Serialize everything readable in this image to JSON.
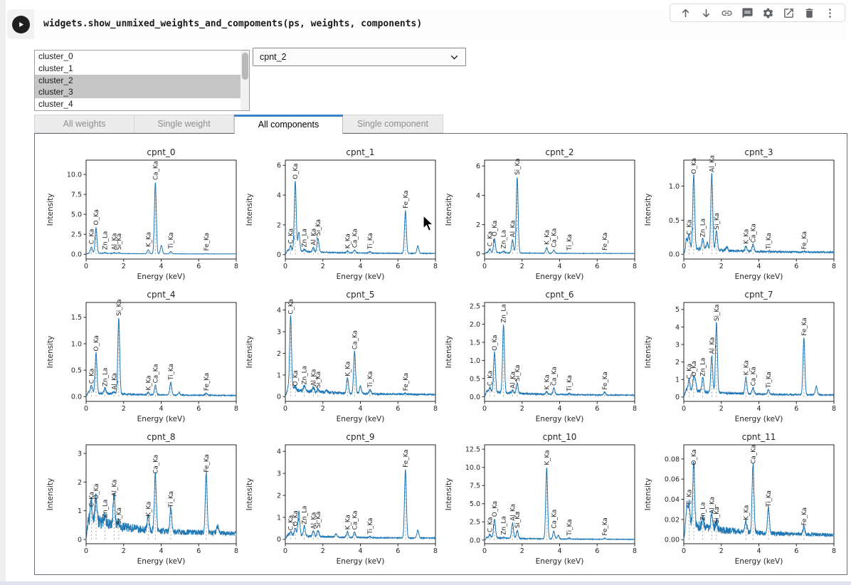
{
  "cell": {
    "code": "widgets.show_unmixed_weights_and_compoments(ps, weights, components)",
    "play_label": "run-cell"
  },
  "toolbar": {
    "icons": [
      {
        "name": "move-cell-up-icon"
      },
      {
        "name": "move-cell-down-icon"
      },
      {
        "name": "copy-link-icon"
      },
      {
        "name": "comment-icon"
      },
      {
        "name": "settings-icon"
      },
      {
        "name": "open-in-new-icon"
      },
      {
        "name": "delete-cell-icon"
      },
      {
        "name": "more-options-icon"
      }
    ]
  },
  "cluster_list": {
    "items": [
      {
        "label": "cluster_0",
        "selected": false
      },
      {
        "label": "cluster_1",
        "selected": false
      },
      {
        "label": "cluster_2",
        "selected": true
      },
      {
        "label": "cluster_3",
        "selected": true
      },
      {
        "label": "cluster_4",
        "selected": false
      }
    ]
  },
  "component_dropdown": {
    "value": "cpnt_2"
  },
  "tabs": [
    {
      "label": "All weights",
      "active": false,
      "width": 141
    },
    {
      "label": "Single weight",
      "active": false,
      "width": 140
    },
    {
      "label": "All components",
      "active": true,
      "width": 153
    },
    {
      "label": "Single component",
      "active": false,
      "width": 141
    }
  ],
  "colors": {
    "line": "#1f77b4",
    "tab_accent": "#3c82c4",
    "axis_text": "#262626",
    "icon_gray": "#5f6368",
    "peak_guide": "#a8a8a8"
  },
  "chart_data": [
    {
      "type": "line",
      "title": "cpnt_0",
      "xlabel": "Energy (keV)",
      "ylabel": "Intensity",
      "xlim": [
        0,
        8
      ],
      "xticks": [
        0,
        2,
        4,
        6,
        8
      ],
      "ylim": [
        -0.6,
        11.8
      ],
      "ytick_vals": [
        0,
        2.5,
        5,
        7.5,
        10
      ],
      "yticks": [
        "0.0",
        "2.5",
        "5.0",
        "7.5",
        "10.0"
      ],
      "peaks": [
        {
          "label": "C_Ka",
          "x": 0.28,
          "h": 0.8
        },
        {
          "label": "O_Ka",
          "x": 0.53,
          "h": 3.2
        },
        {
          "label": "Zn_La",
          "x": 1.01,
          "h": 0.12
        },
        {
          "label": "Al_Ka",
          "x": 1.49,
          "h": 0.1
        },
        {
          "label": "Si_Ka",
          "x": 1.74,
          "h": 0.12
        },
        {
          "label": "K_Ka",
          "x": 3.31,
          "h": 0.5
        },
        {
          "label": "Ca_Ka",
          "x": 3.69,
          "h": 8.9
        },
        {
          "label": "Ti_Ka",
          "x": 4.51,
          "h": 0.3
        },
        {
          "label": "Fe_Ka",
          "x": 6.4,
          "h": 0.05
        }
      ],
      "extra_peaks": [
        {
          "x": 4.01,
          "h": 1.05
        }
      ],
      "baseline": 0.08,
      "noise": 0.06,
      "seed": 1
    },
    {
      "type": "line",
      "title": "cpnt_1",
      "xlabel": "Energy (keV)",
      "ylabel": "Intensity",
      "xlim": [
        0,
        8
      ],
      "xticks": [
        0,
        2,
        4,
        6,
        8
      ],
      "ylim": [
        -0.3,
        6.35
      ],
      "ytick_vals": [
        0,
        2,
        4,
        6
      ],
      "yticks": [
        "0",
        "2",
        "4",
        "6"
      ],
      "peaks": [
        {
          "label": "C_Ka",
          "x": 0.28,
          "h": 0.35
        },
        {
          "label": "O_Ka",
          "x": 0.53,
          "h": 4.7
        },
        {
          "label": "Zn_La",
          "x": 1.01,
          "h": 0.15
        },
        {
          "label": "Al_Ka",
          "x": 1.49,
          "h": 0.3
        },
        {
          "label": "Si_Ka",
          "x": 1.74,
          "h": 0.95
        },
        {
          "label": "K_Ka",
          "x": 3.31,
          "h": 0.12
        },
        {
          "label": "Ca_Ka",
          "x": 3.69,
          "h": 0.18
        },
        {
          "label": "Ti_Ka",
          "x": 4.51,
          "h": 0.1
        },
        {
          "label": "Fe_Ka",
          "x": 6.4,
          "h": 2.85
        }
      ],
      "extra_peaks": [
        {
          "x": 0.72,
          "h": 1.3
        },
        {
          "x": 7.06,
          "h": 0.5
        }
      ],
      "baseline": 0.15,
      "noise": 0.1,
      "seed": 2
    },
    {
      "type": "line",
      "title": "cpnt_2",
      "xlabel": "Energy (keV)",
      "ylabel": "Intensity",
      "xlim": [
        0,
        8
      ],
      "xticks": [
        0,
        2,
        4,
        6,
        8
      ],
      "ylim": [
        -0.35,
        6.4
      ],
      "ytick_vals": [
        0,
        2,
        4,
        6
      ],
      "yticks": [
        "0",
        "2",
        "4",
        "6"
      ],
      "peaks": [
        {
          "label": "C_Ka",
          "x": 0.28,
          "h": 0.25
        },
        {
          "label": "O_Ka",
          "x": 0.53,
          "h": 0.95
        },
        {
          "label": "Zn_La",
          "x": 1.01,
          "h": 0.12
        },
        {
          "label": "Al_Ka",
          "x": 1.49,
          "h": 0.9
        },
        {
          "label": "Si_Ka",
          "x": 1.74,
          "h": 5.15
        },
        {
          "label": "K_Ka",
          "x": 3.31,
          "h": 0.4
        },
        {
          "label": "Ca_Ka",
          "x": 3.69,
          "h": 0.22
        },
        {
          "label": "Ti_Ka",
          "x": 4.51,
          "h": 0.02
        },
        {
          "label": "Fe_Ka",
          "x": 6.4,
          "h": 0.02
        }
      ],
      "extra_peaks": [],
      "baseline": 0.05,
      "noise": 0.05,
      "seed": 3
    },
    {
      "type": "line",
      "title": "cpnt_3",
      "xlabel": "Energy (keV)",
      "ylabel": "Intensity",
      "xlim": [
        0,
        8
      ],
      "xticks": [
        0,
        2,
        4,
        6,
        8
      ],
      "ylim": [
        -0.07,
        1.38
      ],
      "ytick_vals": [
        0,
        0.5,
        1
      ],
      "yticks": [
        "0.0",
        "0.5",
        "1.0"
      ],
      "peaks": [
        {
          "label": "C_Ka",
          "x": 0.28,
          "h": 0.18
        },
        {
          "label": "O_Ka",
          "x": 0.53,
          "h": 1.08
        },
        {
          "label": "Zn_La",
          "x": 1.01,
          "h": 0.16
        },
        {
          "label": "Al_Ka",
          "x": 1.49,
          "h": 1.12
        },
        {
          "label": "Si_Ka",
          "x": 1.74,
          "h": 0.28
        },
        {
          "label": "K_Ka",
          "x": 3.31,
          "h": 0.08
        },
        {
          "label": "Ca_Ka",
          "x": 3.69,
          "h": 0.1
        },
        {
          "label": "Ti_Ka",
          "x": 4.51,
          "h": 0.01
        },
        {
          "label": "Fe_Ka",
          "x": 6.4,
          "h": 0.01
        }
      ],
      "extra_peaks": [
        {
          "x": 0.15,
          "h": 0.12
        },
        {
          "x": 1.25,
          "h": 0.1
        },
        {
          "x": 2.3,
          "h": 0.05
        }
      ],
      "baseline": 0.05,
      "noise": 0.05,
      "seed": 4
    },
    {
      "type": "line",
      "title": "cpnt_4",
      "xlabel": "Energy (keV)",
      "ylabel": "Intensity",
      "xlim": [
        0,
        8
      ],
      "xticks": [
        0,
        2,
        4,
        6,
        8
      ],
      "ylim": [
        -0.09,
        1.78
      ],
      "ytick_vals": [
        0,
        0.5,
        1,
        1.5
      ],
      "yticks": [
        "0.0",
        "0.5",
        "1.0",
        "1.5"
      ],
      "peaks": [
        {
          "label": "C_Ka",
          "x": 0.28,
          "h": 0.14
        },
        {
          "label": "O_Ka",
          "x": 0.53,
          "h": 0.76
        },
        {
          "label": "Zn_La",
          "x": 1.01,
          "h": 0.1
        },
        {
          "label": "Al_Ka",
          "x": 1.49,
          "h": 0.04
        },
        {
          "label": "Si_Ka",
          "x": 1.74,
          "h": 1.44
        },
        {
          "label": "K_Ka",
          "x": 3.31,
          "h": 0.04
        },
        {
          "label": "Ca_Ka",
          "x": 3.69,
          "h": 0.18
        },
        {
          "label": "Ti_Ka",
          "x": 4.51,
          "h": 0.24
        },
        {
          "label": "Fe_Ka",
          "x": 6.4,
          "h": 0.04
        }
      ],
      "extra_peaks": [
        {
          "x": 4.95,
          "h": 0.05
        }
      ],
      "baseline": 0.04,
      "noise": 0.04,
      "seed": 5
    },
    {
      "type": "line",
      "title": "cpnt_5",
      "xlabel": "Energy (keV)",
      "ylabel": "Intensity",
      "xlim": [
        0,
        8
      ],
      "xticks": [
        0,
        2,
        4,
        6,
        8
      ],
      "ylim": [
        -0.22,
        4.35
      ],
      "ytick_vals": [
        0,
        1,
        2,
        3,
        4
      ],
      "yticks": [
        "0",
        "1",
        "2",
        "3",
        "4"
      ],
      "peaks": [
        {
          "label": "C_Ka",
          "x": 0.28,
          "h": 3.45
        },
        {
          "label": "O_Ka",
          "x": 0.53,
          "h": 0.15
        },
        {
          "label": "Zn_La",
          "x": 1.01,
          "h": 0.25
        },
        {
          "label": "Al_Ka",
          "x": 1.49,
          "h": 0.2
        },
        {
          "label": "Si_Ka",
          "x": 1.74,
          "h": 0.12
        },
        {
          "label": "K_Ka",
          "x": 3.31,
          "h": 0.7
        },
        {
          "label": "Ca_Ka",
          "x": 3.69,
          "h": 1.95
        },
        {
          "label": "Ti_Ka",
          "x": 4.51,
          "h": 0.2
        },
        {
          "label": "Fe_Ka",
          "x": 6.4,
          "h": 0.06
        }
      ],
      "extra_peaks": [
        {
          "x": 4.0,
          "h": 0.35
        },
        {
          "x": 2.2,
          "h": 0.1
        }
      ],
      "baseline": 0.18,
      "noise": 0.16,
      "seed": 6
    },
    {
      "type": "line",
      "title": "cpnt_6",
      "xlabel": "Energy (keV)",
      "ylabel": "Intensity",
      "xlim": [
        0,
        8
      ],
      "xticks": [
        0,
        2,
        4,
        6,
        8
      ],
      "ylim": [
        -0.13,
        2.6
      ],
      "ytick_vals": [
        0,
        0.5,
        1,
        1.5,
        2,
        2.5
      ],
      "yticks": [
        "0.0",
        "0.5",
        "1.0",
        "1.5",
        "2.0",
        "2.5"
      ],
      "peaks": [
        {
          "label": "C_Ka",
          "x": 0.28,
          "h": 0.12
        },
        {
          "label": "O_Ka",
          "x": 0.53,
          "h": 1.1
        },
        {
          "label": "Zn_La",
          "x": 1.01,
          "h": 1.88
        },
        {
          "label": "Al_Ka",
          "x": 1.49,
          "h": 0.08
        },
        {
          "label": "Si_Ka",
          "x": 1.74,
          "h": 0.28
        },
        {
          "label": "K_Ka",
          "x": 3.31,
          "h": 0.07
        },
        {
          "label": "Ca_Ka",
          "x": 3.69,
          "h": 0.18
        },
        {
          "label": "Ti_Ka",
          "x": 4.51,
          "h": 0.03
        },
        {
          "label": "Fe_Ka",
          "x": 6.4,
          "h": 0.08
        }
      ],
      "extra_peaks": [],
      "baseline": 0.08,
      "noise": 0.06,
      "seed": 7
    },
    {
      "type": "line",
      "title": "cpnt_7",
      "xlabel": "Energy (keV)",
      "ylabel": "Intensity",
      "xlim": [
        0,
        8
      ],
      "xticks": [
        0,
        2,
        4,
        6,
        8
      ],
      "ylim": [
        -0.25,
        5.4
      ],
      "ytick_vals": [
        0,
        1,
        2,
        3,
        4,
        5
      ],
      "yticks": [
        "0",
        "1",
        "2",
        "3",
        "4",
        "5"
      ],
      "peaks": [
        {
          "label": "C_Ka",
          "x": 0.28,
          "h": 0.6
        },
        {
          "label": "O_Ka",
          "x": 0.53,
          "h": 0.75
        },
        {
          "label": "Zn_La",
          "x": 1.01,
          "h": 0.8
        },
        {
          "label": "Al_Ka",
          "x": 1.49,
          "h": 2.1
        },
        {
          "label": "Si_Ka",
          "x": 1.74,
          "h": 4.0
        },
        {
          "label": "K_Ka",
          "x": 3.31,
          "h": 0.95
        },
        {
          "label": "Ca_Ka",
          "x": 3.69,
          "h": 0.35
        },
        {
          "label": "Ti_Ka",
          "x": 4.51,
          "h": 0.25
        },
        {
          "label": "Fe_Ka",
          "x": 6.4,
          "h": 3.25
        }
      ],
      "extra_peaks": [
        {
          "x": 7.06,
          "h": 0.5
        },
        {
          "x": 0.62,
          "h": 0.5
        }
      ],
      "baseline": 0.22,
      "noise": 0.18,
      "seed": 8
    },
    {
      "type": "line",
      "title": "cpnt_8",
      "xlabel": "Energy (keV)",
      "ylabel": "Intensity",
      "xlim": [
        0,
        8
      ],
      "xticks": [
        0,
        2,
        4,
        6,
        8
      ],
      "ylim": [
        -0.15,
        3.3
      ],
      "ytick_vals": [
        0,
        1,
        2,
        3
      ],
      "yticks": [
        "0",
        "1",
        "2",
        "3"
      ],
      "peaks": [
        {
          "label": "C_Ka",
          "x": 0.28,
          "h": 0.6
        },
        {
          "label": "O_Ka",
          "x": 0.53,
          "h": 0.9
        },
        {
          "label": "Zn_La",
          "x": 1.01,
          "h": 0.3
        },
        {
          "label": "Al_Ka",
          "x": 1.49,
          "h": 1.1
        },
        {
          "label": "Si_Ka",
          "x": 1.74,
          "h": 0.15
        },
        {
          "label": "K_Ka",
          "x": 3.31,
          "h": 0.5
        },
        {
          "label": "Ca_Ka",
          "x": 3.69,
          "h": 2.0
        },
        {
          "label": "Ti_Ka",
          "x": 4.51,
          "h": 0.85
        },
        {
          "label": "Fe_Ka",
          "x": 6.4,
          "h": 2.1
        }
      ],
      "extra_peaks": [
        {
          "x": 7.0,
          "h": 0.25
        }
      ],
      "baseline": 0.35,
      "noise": 0.4,
      "seed": 9
    },
    {
      "type": "line",
      "title": "cpnt_9",
      "xlabel": "Energy (keV)",
      "ylabel": "Intensity",
      "xlim": [
        0,
        8
      ],
      "xticks": [
        0,
        2,
        4,
        6,
        8
      ],
      "ylim": [
        -0.2,
        4.3
      ],
      "ytick_vals": [
        0,
        1,
        2,
        3,
        4
      ],
      "yticks": [
        "0",
        "1",
        "2",
        "3",
        "4"
      ],
      "peaks": [
        {
          "label": "C_Ka",
          "x": 0.28,
          "h": 0.15
        },
        {
          "label": "O_Ka",
          "x": 0.53,
          "h": 0.35
        },
        {
          "label": "Zn_La",
          "x": 1.01,
          "h": 0.45
        },
        {
          "label": "Al_Ka",
          "x": 1.49,
          "h": 0.25
        },
        {
          "label": "Si_Ka",
          "x": 1.74,
          "h": 0.3
        },
        {
          "label": "K_Ka",
          "x": 3.31,
          "h": 0.25
        },
        {
          "label": "Ca_Ka",
          "x": 3.69,
          "h": 0.25
        },
        {
          "label": "Ti_Ka",
          "x": 4.51,
          "h": 0.06
        },
        {
          "label": "Fe_Ka",
          "x": 6.4,
          "h": 3.1
        }
      ],
      "extra_peaks": [
        {
          "x": 0.72,
          "h": 1.1
        },
        {
          "x": 7.06,
          "h": 0.35
        },
        {
          "x": 2.7,
          "h": 0.15
        }
      ],
      "baseline": 0.1,
      "noise": 0.1,
      "seed": 10
    },
    {
      "type": "line",
      "title": "cpnt_10",
      "xlabel": "Energy (keV)",
      "ylabel": "Intensity",
      "xlim": [
        0,
        8
      ],
      "xticks": [
        0,
        2,
        4,
        6,
        8
      ],
      "ylim": [
        -0.5,
        13.1
      ],
      "ytick_vals": [
        0,
        2.5,
        5,
        7.5,
        10,
        12.5
      ],
      "yticks": [
        "0.0",
        "2.5",
        "5.0",
        "7.5",
        "10.0",
        "12.5"
      ],
      "peaks": [
        {
          "label": "C_Ka",
          "x": 0.28,
          "h": 0.45
        },
        {
          "label": "O_Ka",
          "x": 0.53,
          "h": 2.6
        },
        {
          "label": "Zn_La",
          "x": 1.01,
          "h": 0.15
        },
        {
          "label": "Al_Ka",
          "x": 1.49,
          "h": 2.1
        },
        {
          "label": "Si_Ka",
          "x": 1.74,
          "h": 1.1
        },
        {
          "label": "K_Ka",
          "x": 3.31,
          "h": 9.8
        },
        {
          "label": "Ca_Ka",
          "x": 3.69,
          "h": 1.1
        },
        {
          "label": "Ti_Ka",
          "x": 4.51,
          "h": 0.15
        },
        {
          "label": "Fe_Ka",
          "x": 6.4,
          "h": 0.15
        }
      ],
      "extra_peaks": [
        {
          "x": 3.93,
          "h": 0.5
        }
      ],
      "baseline": 0.18,
      "noise": 0.18,
      "seed": 11
    },
    {
      "type": "line",
      "title": "cpnt_11",
      "xlabel": "Energy (keV)",
      "ylabel": "Intensity",
      "xlim": [
        0,
        8
      ],
      "xticks": [
        0,
        2,
        4,
        6,
        8
      ],
      "ylim": [
        -0.004,
        0.094
      ],
      "ytick_vals": [
        0,
        0.02,
        0.04,
        0.06,
        0.08
      ],
      "yticks": [
        "0.00",
        "0.02",
        "0.04",
        "0.06",
        "0.08"
      ],
      "peaks": [
        {
          "label": "C_Ka",
          "x": 0.28,
          "h": 0.022
        },
        {
          "label": "O_Ka",
          "x": 0.53,
          "h": 0.062
        },
        {
          "label": "Zn_La",
          "x": 1.01,
          "h": 0.008
        },
        {
          "label": "Al_Ka",
          "x": 1.49,
          "h": 0.016
        },
        {
          "label": "Si_Ka",
          "x": 1.74,
          "h": 0.007
        },
        {
          "label": "K_Ka",
          "x": 3.31,
          "h": 0.012
        },
        {
          "label": "Ca_Ka",
          "x": 3.69,
          "h": 0.068
        },
        {
          "label": "Ti_Ka",
          "x": 4.51,
          "h": 0.026
        },
        {
          "label": "Fe_Ka",
          "x": 6.4,
          "h": 0.008
        }
      ],
      "extra_peaks": [
        {
          "x": 0.15,
          "h": 0.015
        }
      ],
      "baseline": 0.008,
      "noise": 0.009,
      "seed": 12
    }
  ]
}
